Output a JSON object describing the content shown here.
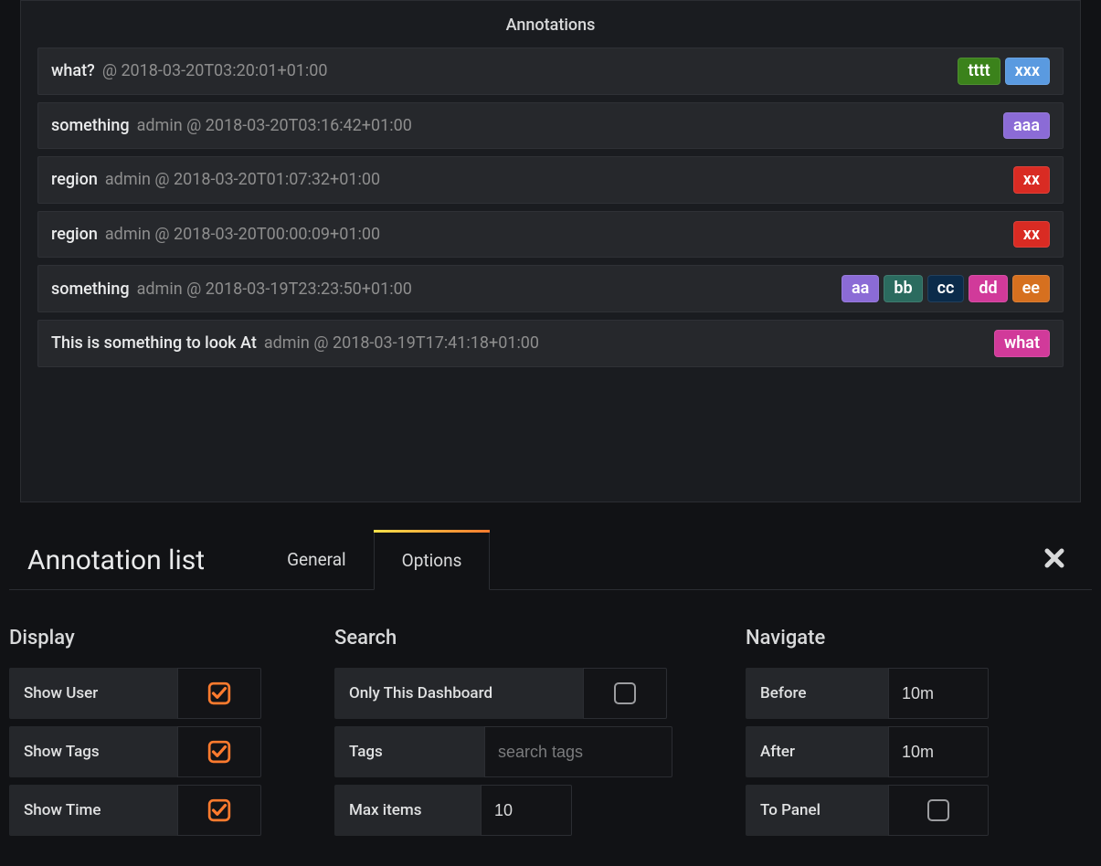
{
  "panel": {
    "title": "Annotations",
    "items": [
      {
        "title": "what?",
        "user": "",
        "time": "2018-03-20T03:20:01+01:00",
        "tags": [
          {
            "label": "tttt",
            "bg": "#3b821b"
          },
          {
            "label": "xxx",
            "bg": "#5a9ae0"
          }
        ]
      },
      {
        "title": "something",
        "user": "admin",
        "time": "2018-03-20T03:16:42+01:00",
        "tags": [
          {
            "label": "aaa",
            "bg": "#8b6bd6"
          }
        ]
      },
      {
        "title": "region",
        "user": "admin",
        "time": "2018-03-20T01:07:32+01:00",
        "tags": [
          {
            "label": "xx",
            "bg": "#d92b23"
          }
        ]
      },
      {
        "title": "region",
        "user": "admin",
        "time": "2018-03-20T00:00:09+01:00",
        "tags": [
          {
            "label": "xx",
            "bg": "#d92b23"
          }
        ]
      },
      {
        "title": "something",
        "user": "admin",
        "time": "2018-03-19T23:23:50+01:00",
        "tags": [
          {
            "label": "aa",
            "bg": "#8b6bd6"
          },
          {
            "label": "bb",
            "bg": "#2b6b5f"
          },
          {
            "label": "cc",
            "bg": "#0b2b4a"
          },
          {
            "label": "dd",
            "bg": "#d13a9a"
          },
          {
            "label": "ee",
            "bg": "#d6701f"
          }
        ]
      },
      {
        "title": "This is something to look At",
        "user": "admin",
        "time": "2018-03-19T17:41:18+01:00",
        "tags": [
          {
            "label": "what",
            "bg": "#d13a9a"
          }
        ]
      }
    ]
  },
  "editor": {
    "title": "Annotation list",
    "tabs": {
      "general": "General",
      "options": "Options"
    },
    "display": {
      "heading": "Display",
      "show_user": "Show User",
      "show_tags": "Show Tags",
      "show_time": "Show Time",
      "show_user_checked": true,
      "show_tags_checked": true,
      "show_time_checked": true
    },
    "search": {
      "heading": "Search",
      "only_dashboard": "Only This Dashboard",
      "only_dashboard_checked": false,
      "tags_label": "Tags",
      "tags_value": "",
      "tags_placeholder": "search tags",
      "max_items_label": "Max items",
      "max_items_value": "10"
    },
    "navigate": {
      "heading": "Navigate",
      "before_label": "Before",
      "before_value": "10m",
      "after_label": "After",
      "after_value": "10m",
      "to_panel_label": "To Panel",
      "to_panel_checked": false
    }
  }
}
